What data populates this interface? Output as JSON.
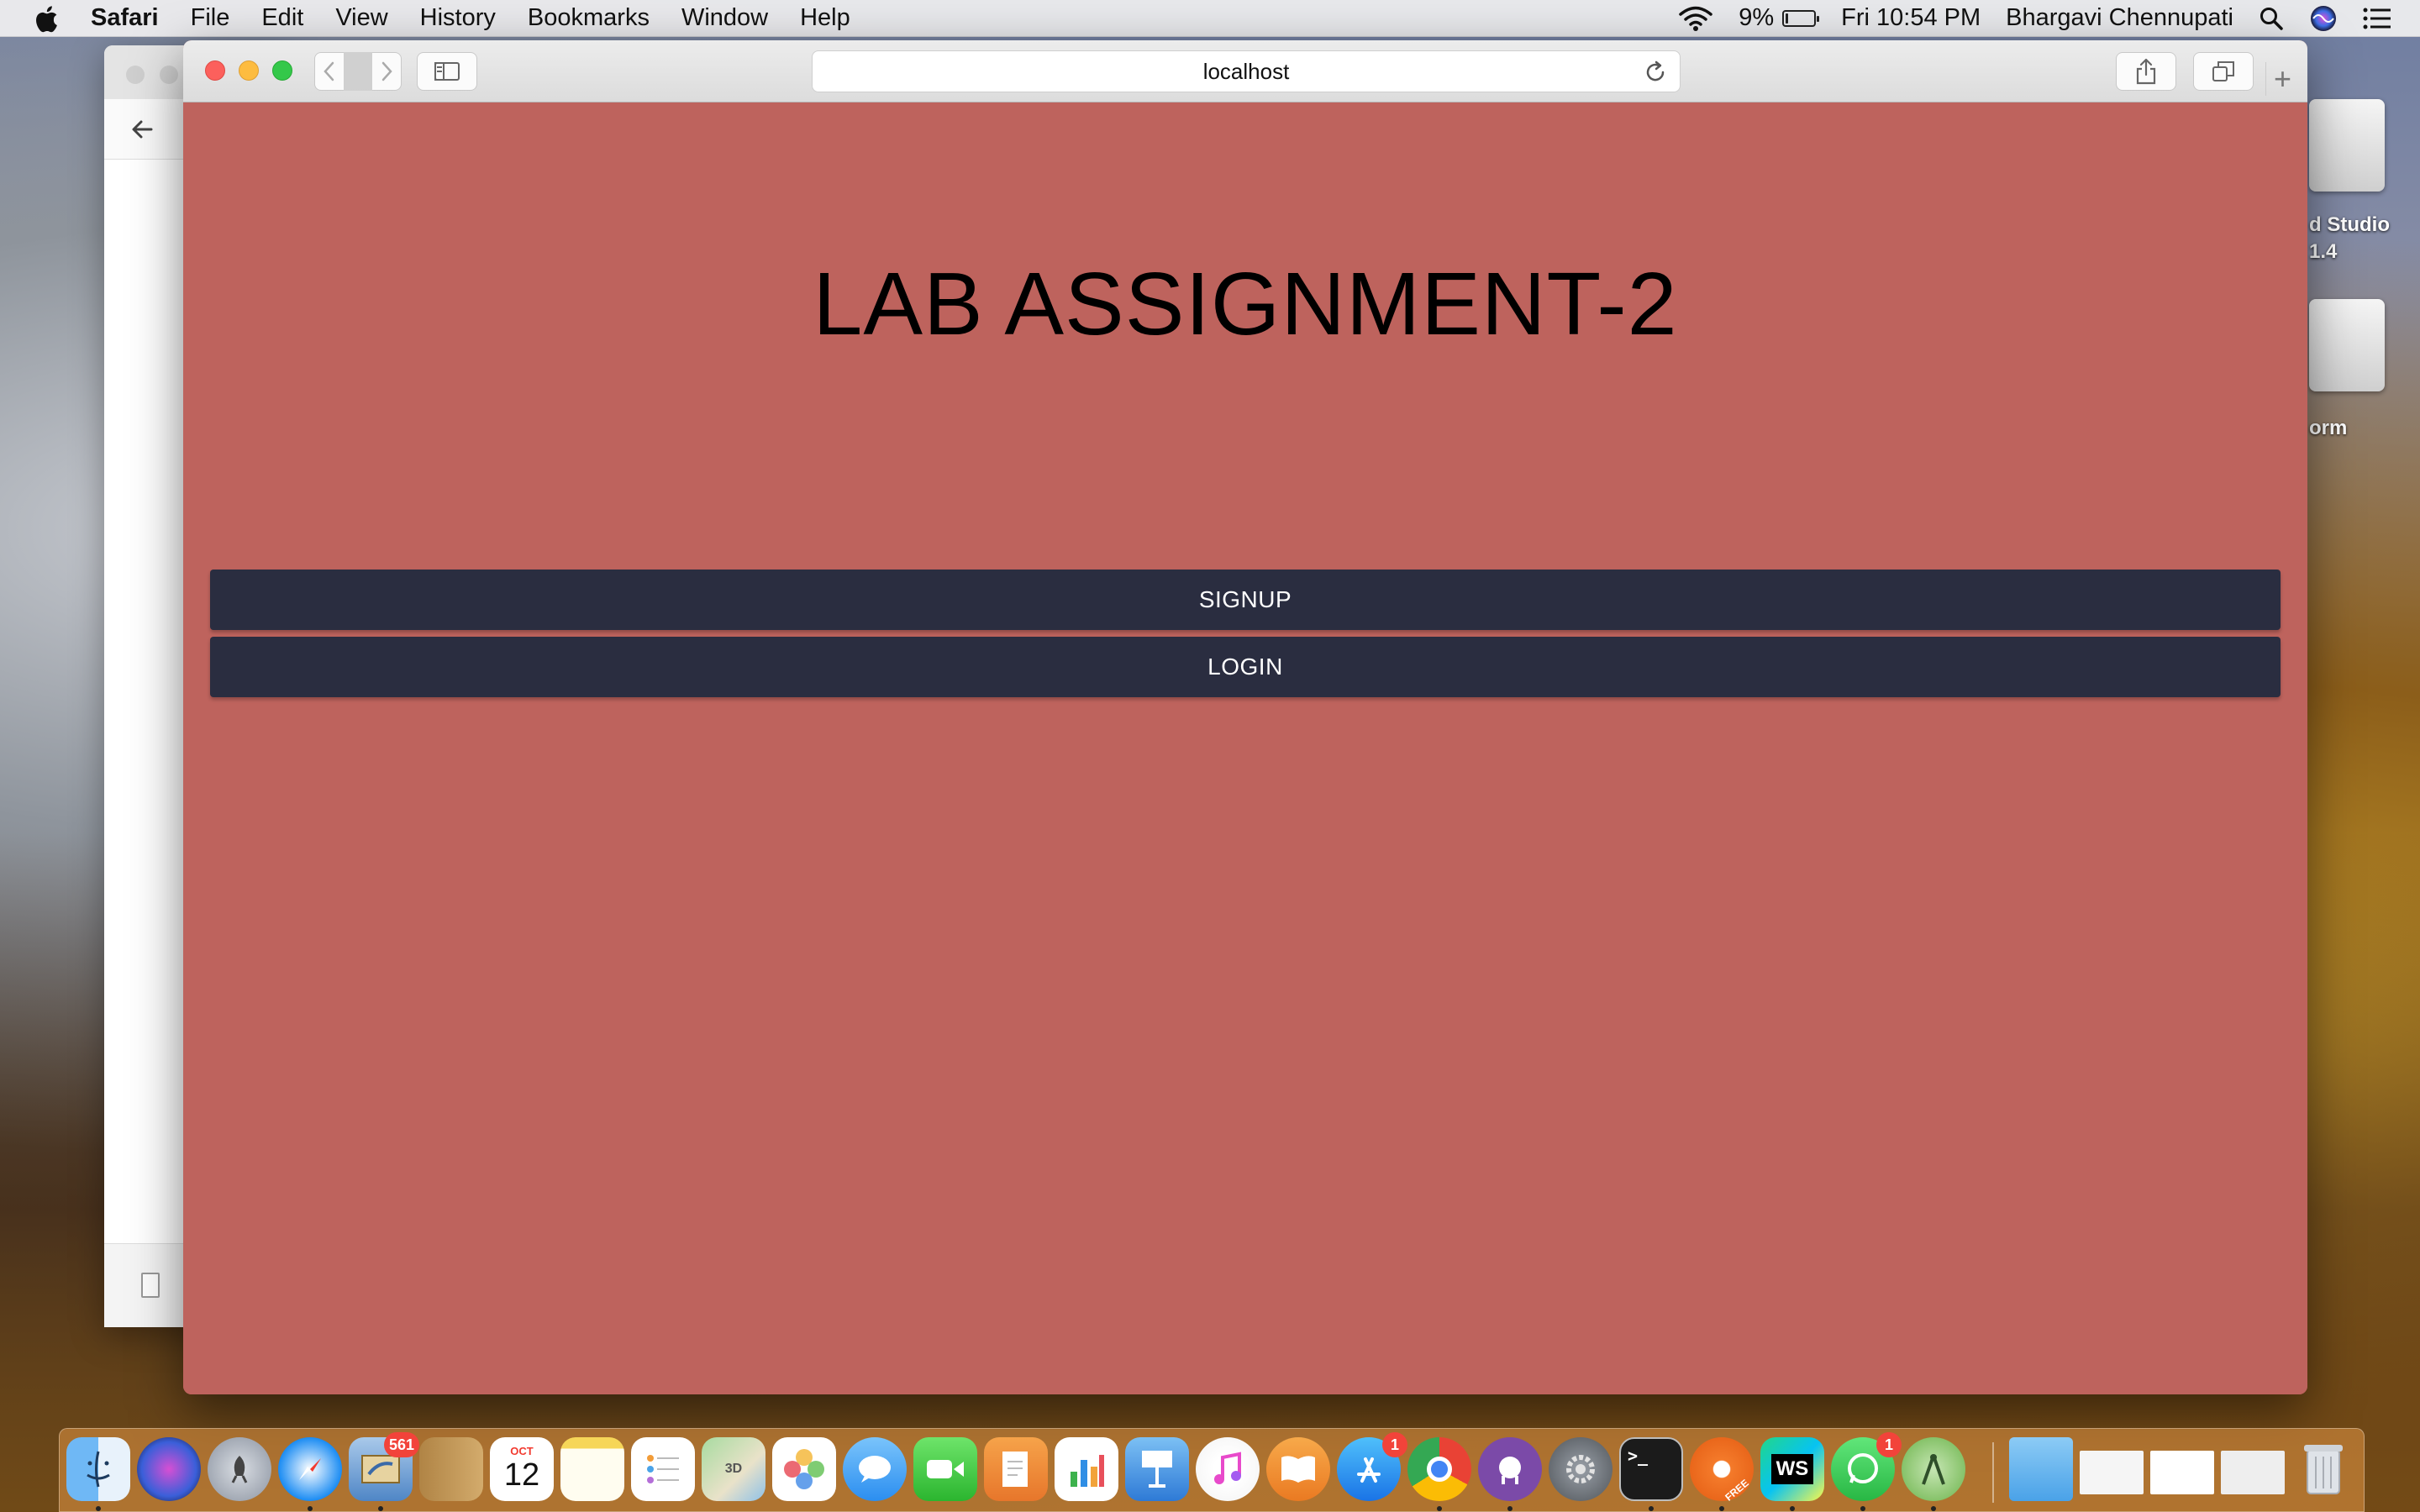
{
  "menubar": {
    "app_name": "Safari",
    "menus": [
      "File",
      "Edit",
      "View",
      "History",
      "Bookmarks",
      "Window",
      "Help"
    ],
    "battery_percent": "9%",
    "battery_level": 0.09,
    "clock": "Fri 10:54 PM",
    "user": "Bhargavi Chennupati"
  },
  "safari": {
    "url": "localhost"
  },
  "page": {
    "title": "LAB ASSIGNMENT-2",
    "signup_label": "SIGNUP",
    "login_label": "LOGIN",
    "background_color": "#be635d",
    "button_color": "#2a2d40"
  },
  "desktop": {
    "icon_labels": [
      "d Studio",
      "1.4",
      "orm"
    ]
  },
  "dock": {
    "calendar_month": "OCT",
    "calendar_day": "12",
    "mail_badge": "561",
    "appstore_badge": "1",
    "whatsapp_badge": "1",
    "webstorm_label": "WS",
    "terminal_label": ">_",
    "free_label": "FREE",
    "maps_label": "3D"
  }
}
